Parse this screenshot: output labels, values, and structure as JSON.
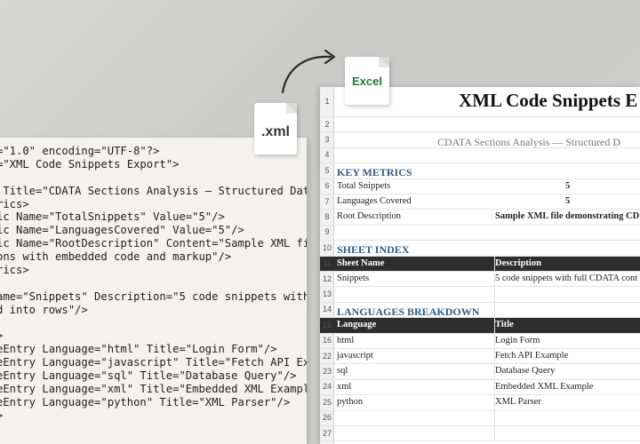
{
  "code_panel": {
    "lines": [
      "=\"1.0\" encoding=\"UTF-8\"?>",
      "=\"XML Code Snippets Export\">",
      "",
      " Title=\"CDATA Sections Analysis — Structured Data Extra",
      "rics>",
      "ic Name=\"TotalSnippets\" Value=\"5\"/>",
      "ic Name=\"LanguagesCovered\" Value=\"5\"/>",
      "ic Name=\"RootDescription\" Content=\"Sample XML file demo",
      "ons with embedded code and markup\"/>",
      "rics>",
      "",
      "ame=\"Snippets\" Description=\"5 code snippets with full",
      "d into rows\"/>",
      "",
      ">",
      "eEntry Language=\"html\" Title=\"Login Form\"/>",
      "eEntry Language=\"javascript\" Title=\"Fetch API Example\"",
      "eEntry Language=\"sql\" Title=\"Database Query\"/>",
      "eEntry Language=\"xml\" Title=\"Embedded XML Example\"/>",
      "eEntry Language=\"python\" Title=\"XML Parser\"/>",
      ">"
    ]
  },
  "badges": {
    "xml_label": ".xml",
    "excel_label": "Excel"
  },
  "colors": {
    "section_heading": "#2f5d8c",
    "header_fill": "#2e2e2e",
    "excel_green": "#1f7a35"
  },
  "sheet": {
    "title": "XML Code Snippets E",
    "subtitle": "CDATA Sections Analysis — Structured D",
    "key_metrics": {
      "heading": "KEY METRICS",
      "rows": [
        {
          "label": "Total Snippets",
          "value": "5"
        },
        {
          "label": "Languages Covered",
          "value": "5"
        },
        {
          "label": "Root Description",
          "value": "Sample XML file demonstrating CD"
        }
      ]
    },
    "sheet_index": {
      "heading": "SHEET INDEX",
      "headers": [
        "Sheet Name",
        "Description"
      ],
      "rows": [
        {
          "name": "Snippets",
          "description": "5 code snippets with full CDATA cont"
        }
      ]
    },
    "languages": {
      "heading": "LANGUAGES BREAKDOWN",
      "headers": [
        "Language",
        "Title"
      ],
      "rows": [
        {
          "language": "html",
          "title": "Login Form"
        },
        {
          "language": "javascript",
          "title": "Fetch API Example"
        },
        {
          "language": "sql",
          "title": "Database Query"
        },
        {
          "language": "xml",
          "title": "Embedded XML Example"
        },
        {
          "language": "python",
          "title": "XML Parser"
        }
      ]
    },
    "row_numbers": [
      "1",
      "2",
      "3",
      "4",
      "5",
      "6",
      "7",
      "8",
      "9",
      "10",
      "11",
      "12",
      "13",
      "14",
      "15",
      "16",
      "22",
      "23",
      "24",
      "25",
      "26",
      "27"
    ]
  }
}
